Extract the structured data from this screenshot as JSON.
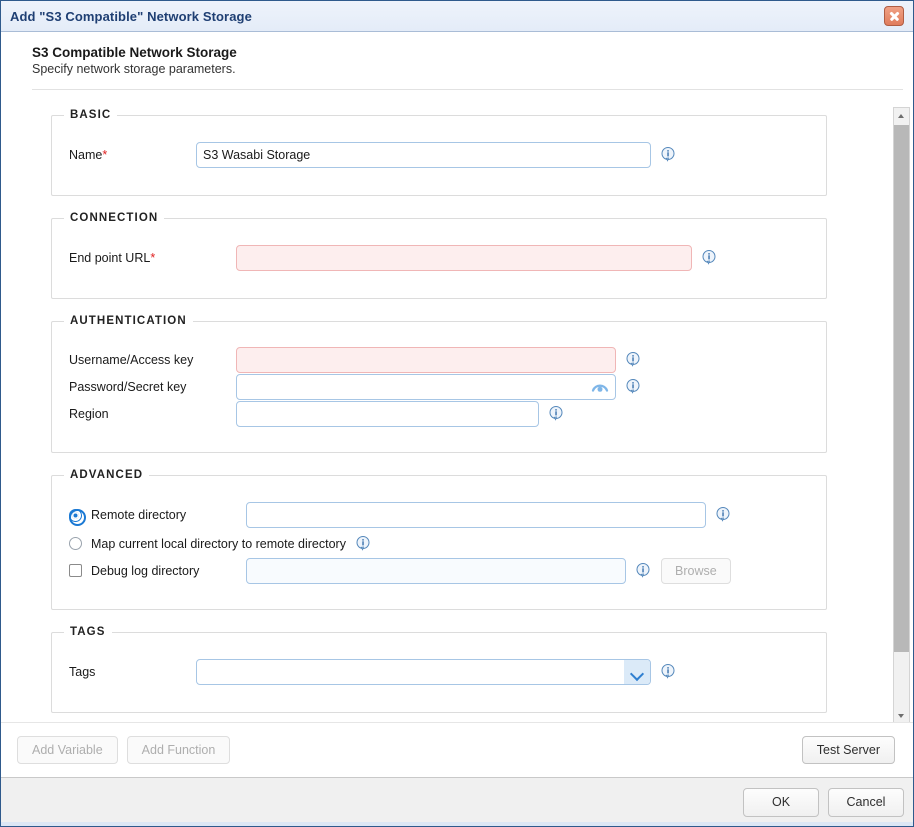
{
  "window": {
    "title": "Add \"S3 Compatible\" Network Storage",
    "close_icon": "close-icon"
  },
  "header": {
    "title": "S3 Compatible Network Storage",
    "subtitle": "Specify network storage parameters."
  },
  "groups": {
    "basic": {
      "legend": "BASIC",
      "name_label": "Name",
      "name_required": "*",
      "name_value": "S3 Wasabi Storage",
      "name_placeholder": ""
    },
    "connection": {
      "legend": "CONNECTION",
      "endpoint_label": "End point URL",
      "endpoint_required": "*",
      "endpoint_value": "",
      "endpoint_placeholder": ""
    },
    "authentication": {
      "legend": "AUTHENTICATION",
      "username_label": "Username/Access key",
      "username_value": "",
      "password_label": "Password/Secret key",
      "password_value": "",
      "region_label": "Region",
      "region_value": ""
    },
    "advanced": {
      "legend": "ADVANCED",
      "remote_directory_label": "Remote directory",
      "remote_directory_value": "",
      "remote_directory_selected": true,
      "map_local_label": "Map current local directory to remote directory",
      "map_local_selected": false,
      "debug_log_label": "Debug log directory",
      "debug_log_value": "",
      "debug_log_checked": false,
      "browse_label": "Browse",
      "browse_disabled": true
    },
    "tags": {
      "legend": "TAGS",
      "tags_label": "Tags",
      "tags_value": "",
      "tags_placeholder": ""
    }
  },
  "actions": {
    "add_variable_label": "Add Variable",
    "add_variable_disabled": true,
    "add_function_label": "Add Function",
    "add_function_disabled": true,
    "test_server_label": "Test Server"
  },
  "footer": {
    "ok_label": "OK",
    "cancel_label": "Cancel"
  },
  "scrollbar": {
    "up_icon": "scroll-up-arrow-icon",
    "down_icon": "scroll-down-arrow-icon"
  },
  "colors": {
    "title_text": "#1f3f73",
    "accent_blue": "#1a79d4",
    "field_border": "#a7c6e5",
    "error_bg": "#fdeeee",
    "error_border": "#f0b6b6",
    "required_asterisk": "#e02020",
    "close_button": "#e07c5c"
  }
}
